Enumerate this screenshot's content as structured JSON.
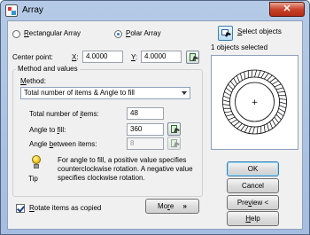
{
  "window": {
    "title": "Array",
    "close_glyph": "✕"
  },
  "array_type": {
    "rectangular_prefix": "R",
    "rectangular_rest": "ectangular Array",
    "polar_prefix": "P",
    "polar_rest": "olar Array",
    "selected": "polar"
  },
  "center_point": {
    "label": "Center point:",
    "x_label_u": "X",
    "x_label_rest": ":",
    "x_value": "4.0000",
    "y_label_u": "Y",
    "y_label_rest": ":",
    "y_value": "4.0000"
  },
  "method_group": {
    "title": "Method and values",
    "method_label_u": "M",
    "method_label_rest": "ethod:",
    "method_value": "Total number of items & Angle to fill",
    "total_items_label_pre": "Total number of ",
    "total_items_label_u": "i",
    "total_items_label_post": "tems:",
    "total_items_value": "48",
    "angle_fill_label_pre": "Angle to ",
    "angle_fill_label_u": "f",
    "angle_fill_label_post": "ill:",
    "angle_fill_value": "360",
    "angle_between_label_pre": "Angle ",
    "angle_between_label_u": "b",
    "angle_between_label_post": "etween items:",
    "angle_between_value": "8"
  },
  "tip": {
    "caption": "Tip",
    "text": "For angle to fill, a positive value specifies counterclockwise rotation. A negative value specifies clockwise rotation."
  },
  "rotate": {
    "label_u": "R",
    "label_rest": "otate items as copied",
    "checked": true
  },
  "more_button": {
    "label_pre": "Mo",
    "label_u": "r",
    "label_post": "e",
    "glyph": "»"
  },
  "select_objects": {
    "label_u": "S",
    "label_rest": "elect objects",
    "status": "1 objects selected"
  },
  "preview": {
    "item_count": 48
  },
  "buttons": {
    "ok": "OK",
    "cancel": "Cancel",
    "preview_pre": "Pre",
    "preview_u": "v",
    "preview_post": "iew <",
    "help_u": "H",
    "help_rest": "elp"
  }
}
